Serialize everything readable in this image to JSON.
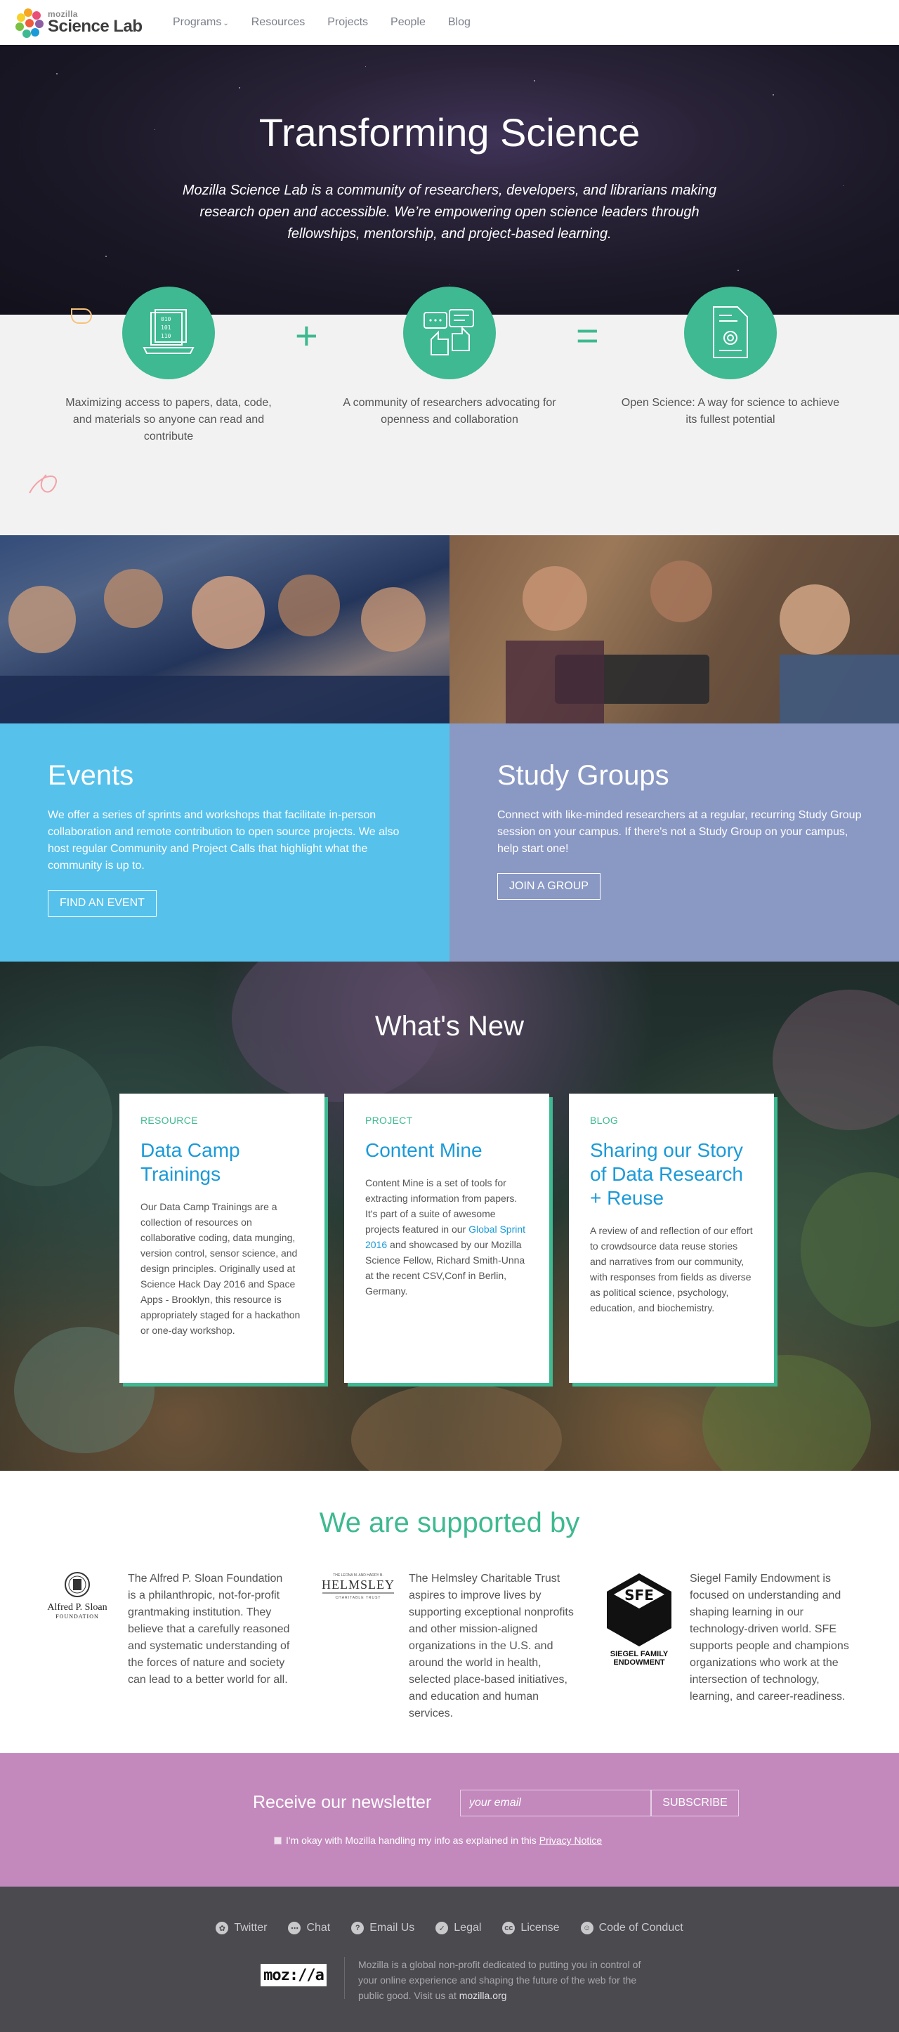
{
  "nav": {
    "logo_small": "mozilla",
    "logo_big": "Science Lab",
    "items": [
      "Programs",
      "Resources",
      "Projects",
      "People",
      "Blog"
    ]
  },
  "hero": {
    "title": "Transforming Science",
    "subtitle": "Mozilla Science Lab is a community of researchers, developers, and librarians making research open and accessible. We’re empowering open science leaders through fellowships, mentorship, and project-based learning."
  },
  "pillars": {
    "plus": "+",
    "equals": "=",
    "items": [
      {
        "icon": "laptop-data-icon",
        "text": "Maximizing access to papers, data, code, and materials so anyone can read and contribute"
      },
      {
        "icon": "community-chat-icon",
        "text": "A community of researchers advocating for openness and collaboration"
      },
      {
        "icon": "certificate-icon",
        "text": "Open Science: A way for science to achieve its fullest potential"
      }
    ]
  },
  "events": {
    "title": "Events",
    "text": "We offer a series of sprints and workshops that facilitate in-person collaboration and remote contribution to open source projects. We also host regular Community and Project Calls that highlight what the community is up to.",
    "button": "FIND AN EVENT",
    "color": "#56c1eb"
  },
  "study": {
    "title": "Study Groups",
    "text": "Connect with like-minded researchers at a regular, recurring Study Group session on your campus. If there's not a Study Group on your campus, help start one!",
    "button": "JOIN A GROUP",
    "color": "#8a98c4"
  },
  "news": {
    "title": "What's New",
    "cards": [
      {
        "category": "RESOURCE",
        "title": "Data Camp Trainings",
        "text": "Our Data Camp Trainings are a collection of resources on collaborative coding, data munging, version control, sensor science, and design principles. Originally used at Science Hack Day 2016 and Space Apps - Brooklyn, this resource is appropriately staged for a hackathon or one-day workshop."
      },
      {
        "category": "PROJECT",
        "title": "Content Mine",
        "text_before": "Content Mine is a set of tools for extracting information from papers. It's part of a suite of awesome projects featured in our ",
        "link": "Global Sprint 2016",
        "text_after": " and showcased by our Mozilla Science Fellow, Richard Smith-Unna at the recent CSV,Conf in Berlin, Germany."
      },
      {
        "category": "BLOG",
        "title": "Sharing our Story of Data Research + Reuse",
        "text": "A review of and reflection of our effort to crowdsource data reuse stories and narratives from our community, with responses from fields as diverse as political science, psychology, education, and biochemistry."
      }
    ]
  },
  "support": {
    "title": "We are supported by",
    "sponsors": [
      {
        "logo_text": "Alfred P. Sloan",
        "logo_sub": "FOUNDATION",
        "text": "The Alfred P. Sloan Foundation is a philanthropic, not-for-profit grantmaking institution. They believe that a carefully reasoned and systematic understanding of the forces of nature and society can lead to a better world for all."
      },
      {
        "logo_top": "THE LEONA M. AND HARRY B.",
        "logo_text": "HELMSLEY",
        "logo_sub": "CHARITABLE TRUST",
        "text": "The Helmsley Charitable Trust aspires to improve lives by supporting exceptional nonprofits and other mission-aligned organizations in the U.S. and around the world in health, selected place-based initiatives, and education and human services."
      },
      {
        "logo_mark": "SFE",
        "logo_text": "SIEGEL FAMILY",
        "logo_sub": "ENDOWMENT",
        "text": "Siegel Family Endowment is focused on understanding and shaping learning in our technology-driven world. SFE supports people and champions organizations who work at the intersection of technology, learning, and career-readiness."
      }
    ]
  },
  "newsletter": {
    "title": "Receive our newsletter",
    "placeholder": "your email",
    "button": "SUBSCRIBE",
    "consent": "I'm okay with Mozilla handling my info as explained in this",
    "consent_link": "Privacy Notice",
    "color": "#c389bd"
  },
  "footer": {
    "links": [
      {
        "label": "Twitter",
        "icon": "twitter-icon"
      },
      {
        "label": "Chat",
        "icon": "chat-icon"
      },
      {
        "label": "Email Us",
        "icon": "question-icon"
      },
      {
        "label": "Legal",
        "icon": "check-icon"
      },
      {
        "label": "License",
        "icon": "cc-icon"
      },
      {
        "label": "Code of Conduct",
        "icon": "smile-icon"
      }
    ],
    "logo": "moz://a",
    "about": "Mozilla is a global non-profit dedicated to putting you in control of your online experience and shaping the future of the web for the public good. Visit us at",
    "about_link": "mozilla.org"
  }
}
